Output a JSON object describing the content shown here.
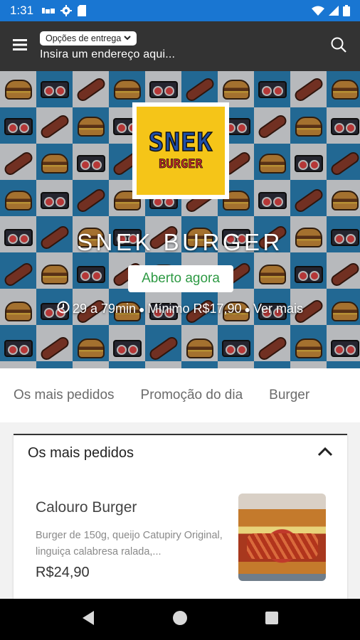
{
  "status_bar": {
    "time": "1:31",
    "background_color": "#1976d2",
    "left_icons": [
      "notification-icon",
      "settings-icon",
      "sim-card-icon"
    ],
    "right_icons": [
      "wifi-icon",
      "signal-icon",
      "battery-icon"
    ]
  },
  "app_bar": {
    "background_color": "#333333",
    "delivery_options_label": "Opções de entrega",
    "address_placeholder": "Insira um endereço aqui...",
    "menu_icon": "menu-icon",
    "search_icon": "search-icon"
  },
  "store": {
    "logo_line1": "SNEK",
    "logo_line2": "BURGER",
    "name": "SNEK BURGER",
    "status": "Aberto agora",
    "status_color": "#2e9a44",
    "delivery_time": "29 a 79min",
    "minimum": "Mínimo R$17,90",
    "more": "Ver mais"
  },
  "tabs": [
    {
      "label": "Os mais pedidos"
    },
    {
      "label": "Promoção do dia"
    },
    {
      "label": "Burger"
    }
  ],
  "section": {
    "title": "Os mais pedidos",
    "expanded": true,
    "items": [
      {
        "name": "Calouro Burger",
        "description": "Burger de 150g, queijo Catupiry Original, linguiça calabresa ralada,...",
        "price": "R$24,90"
      }
    ]
  },
  "nav_bar": {
    "buttons": [
      "back-icon",
      "home-icon",
      "recents-icon"
    ]
  }
}
